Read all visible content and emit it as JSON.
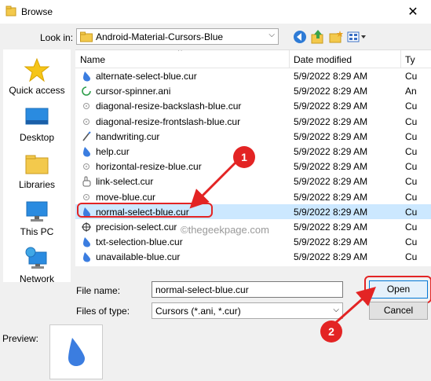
{
  "window": {
    "title": "Browse",
    "close_glyph": "✕"
  },
  "look_in": {
    "label": "Look in:",
    "value": "Android-Material-Cursors-Blue"
  },
  "places": [
    {
      "label": "Quick access",
      "icon": "star-icon"
    },
    {
      "label": "Desktop",
      "icon": "desktop-icon"
    },
    {
      "label": "Libraries",
      "icon": "libraries-icon"
    },
    {
      "label": "This PC",
      "icon": "pc-icon"
    },
    {
      "label": "Network",
      "icon": "network-icon"
    }
  ],
  "columns": {
    "name": "Name",
    "date": "Date modified",
    "type": "Ty"
  },
  "files": [
    {
      "name": "alternate-select-blue.cur",
      "date": "5/9/2022 8:29 AM",
      "type": "Cu",
      "icon": "drop"
    },
    {
      "name": "cursor-spinner.ani",
      "date": "5/9/2022 8:29 AM",
      "type": "An",
      "icon": "spinner"
    },
    {
      "name": "diagonal-resize-backslash-blue.cur",
      "date": "5/9/2022 8:29 AM",
      "type": "Cu",
      "icon": "diag"
    },
    {
      "name": "diagonal-resize-frontslash-blue.cur",
      "date": "5/9/2022 8:29 AM",
      "type": "Cu",
      "icon": "diag"
    },
    {
      "name": "handwriting.cur",
      "date": "5/9/2022 8:29 AM",
      "type": "Cu",
      "icon": "pen"
    },
    {
      "name": "help.cur",
      "date": "5/9/2022 8:29 AM",
      "type": "Cu",
      "icon": "drop"
    },
    {
      "name": "horizontal-resize-blue.cur",
      "date": "5/9/2022 8:29 AM",
      "type": "Cu",
      "icon": "diag"
    },
    {
      "name": "link-select.cur",
      "date": "5/9/2022 8:29 AM",
      "type": "Cu",
      "icon": "hand"
    },
    {
      "name": "move-blue.cur",
      "date": "5/9/2022 8:29 AM",
      "type": "Cu",
      "icon": "move"
    },
    {
      "name": "normal-select-blue.cur",
      "date": "5/9/2022 8:29 AM",
      "type": "Cu",
      "icon": "drop",
      "selected": true
    },
    {
      "name": "precision-select.cur",
      "date": "5/9/2022 8:29 AM",
      "type": "Cu",
      "icon": "cross"
    },
    {
      "name": "txt-selection-blue.cur",
      "date": "5/9/2022 8:29 AM",
      "type": "Cu",
      "icon": "drop"
    },
    {
      "name": "unavailable-blue.cur",
      "date": "5/9/2022 8:29 AM",
      "type": "Cu",
      "icon": "drop"
    }
  ],
  "watermark": "©thegeekpage.com",
  "file_name": {
    "label": "File name:",
    "value": "normal-select-blue.cur"
  },
  "file_type": {
    "label": "Files of type:",
    "value": "Cursors (*.ani, *.cur)"
  },
  "buttons": {
    "open": "Open",
    "cancel": "Cancel"
  },
  "preview": {
    "label": "Preview:"
  },
  "annotations": {
    "badge1": "1",
    "badge2": "2"
  },
  "colors": {
    "accent": "#0078d7",
    "highlight": "#e32424",
    "selection": "#cce8ff",
    "cursor_blue": "#3b7de0"
  }
}
